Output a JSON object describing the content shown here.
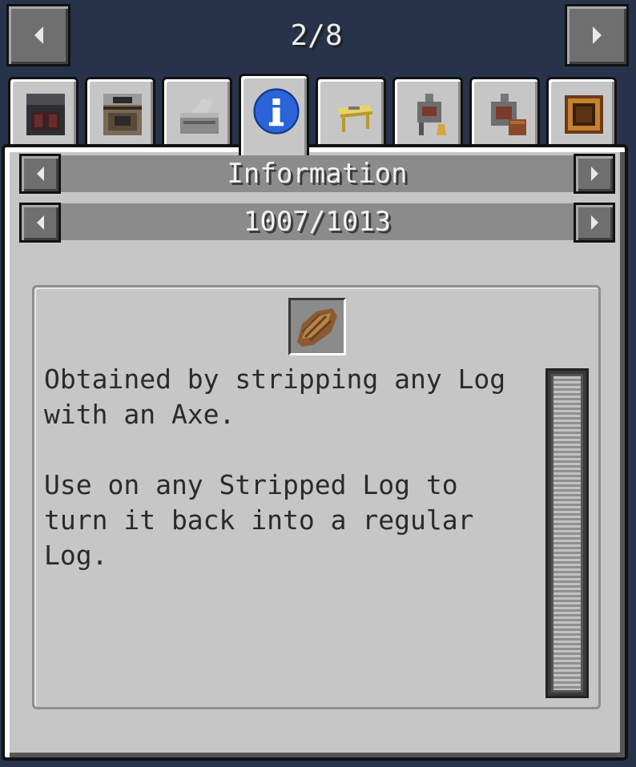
{
  "top_nav": {
    "page_counter": "2/8",
    "prev_icon": "arrow-left-icon",
    "next_icon": "arrow-right-icon"
  },
  "tabs": [
    {
      "name": "tab-blast-furnace",
      "icon": "blast-furnace-icon"
    },
    {
      "name": "tab-furnace",
      "icon": "stone-furnace-icon"
    },
    {
      "name": "tab-stonecutter",
      "icon": "stonecutter-icon"
    },
    {
      "name": "tab-information",
      "icon": "info-icon",
      "active": true
    },
    {
      "name": "tab-crafting-table",
      "icon": "golden-table-icon"
    },
    {
      "name": "tab-machine-a",
      "icon": "machine-icon"
    },
    {
      "name": "tab-machine-b",
      "icon": "machine-crafting-icon"
    },
    {
      "name": "tab-crate",
      "icon": "wooden-crate-icon"
    }
  ],
  "category": {
    "label": "Information"
  },
  "recipe": {
    "counter": "1007/1013"
  },
  "item": {
    "icon": "stripped-bark-icon"
  },
  "description": {
    "paragraph1": "Obtained by stripping any Log with an Axe.",
    "paragraph2": "Use on any Stripped Log to turn it back into a regular Log."
  },
  "colors": {
    "background": "#27334a",
    "panel": "#c6c6c6",
    "bar": "#8b8b8b",
    "info_blue": "#2b63d9"
  }
}
